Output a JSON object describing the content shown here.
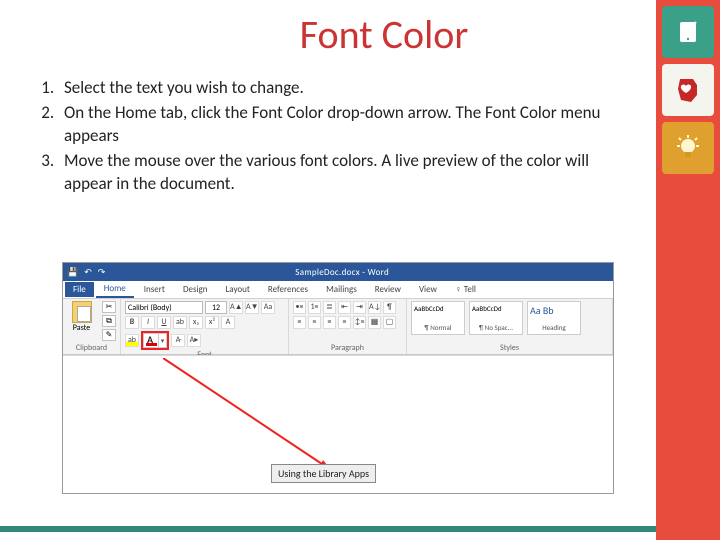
{
  "title": "Font Color",
  "steps": [
    "Select the text you wish to change.",
    "On the Home tab, click the Font Color drop-down arrow.  The Font Color menu appears",
    "Move the mouse over the various font colors.  A live preview of the color will appear in the document."
  ],
  "word": {
    "doc_title": "SampleDoc.docx - Word",
    "qat": {
      "save": "💾",
      "undo": "↶",
      "redo": "↷"
    },
    "tabs": [
      "File",
      "Home",
      "Insert",
      "Design",
      "Layout",
      "References",
      "Mailings",
      "Review",
      "View",
      "♀ Tell"
    ],
    "active_tab": "Home",
    "font": {
      "name": "Calibri (Body)",
      "size": "12"
    },
    "groups": {
      "clipboard": "Clipboard",
      "font": "Font",
      "paragraph": "Paragraph",
      "styles": "Styles"
    },
    "paste_label": "Paste",
    "styles": [
      {
        "preview": "AaBbCcDd",
        "label": "¶ Normal"
      },
      {
        "preview": "AaBbCcDd",
        "label": "¶ No Spac..."
      },
      {
        "preview": "Aa Bb",
        "label": "Heading"
      }
    ],
    "doc_text": "Using the Library Apps"
  },
  "sidebar_icons": [
    "tablet",
    "heart",
    "bulb"
  ]
}
